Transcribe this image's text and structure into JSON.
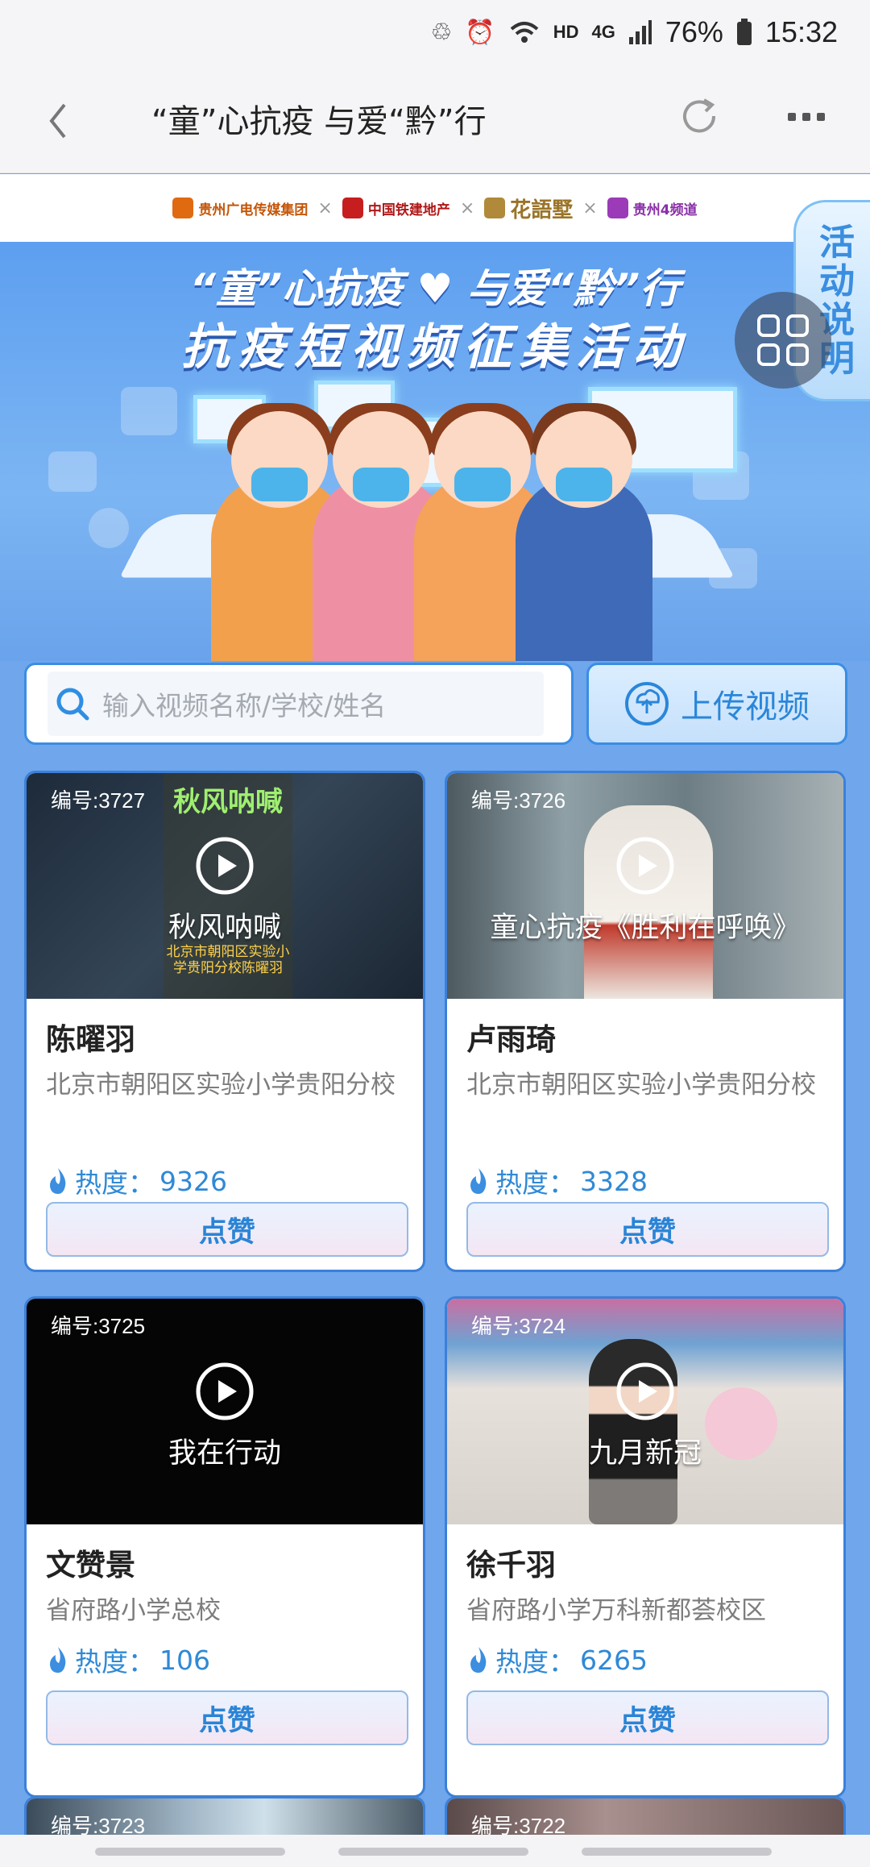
{
  "status_bar": {
    "icons": [
      "sync-icon",
      "alarm-icon",
      "wifi-icon",
      "signal-icon",
      "battery-icon"
    ],
    "hd_label": "HD",
    "network_label": "4G",
    "battery": "76%",
    "time": "15:32"
  },
  "nav": {
    "title": "“童”心抗疫 与爱“黔”行",
    "back_icon": "chevron-left-icon",
    "refresh_icon": "refresh-icon",
    "more_icon": "more-icon"
  },
  "sponsors": [
    {
      "name": "贵州广电传媒集团",
      "color": "#e06a10"
    },
    {
      "name": "中国铁建地产",
      "color": "#c61e1e"
    },
    {
      "name": "花語墅",
      "color": "#b08a3a"
    },
    {
      "name": "贵州4频道",
      "color": "#9b3bb8"
    }
  ],
  "sponsor_separator": "×",
  "banner": {
    "title_line1": "“童”心抗疫 ♥ 与爱“黔”行",
    "title_line2": "抗疫短视频征集活动"
  },
  "side_tab": {
    "label": "活动说明"
  },
  "search": {
    "placeholder": "输入视频名称/学校/姓名"
  },
  "upload": {
    "label": "上传视频"
  },
  "cards": [
    {
      "id_label": "编号:3727",
      "caption": "秋风呐喊",
      "name": "陈曜羽",
      "school": "北京市朝阳区实验小学贵阳分校",
      "heat_label": "热度：",
      "heat": "9326",
      "like_label": "点赞"
    },
    {
      "id_label": "编号:3726",
      "caption": "童心抗疫《胜利在呼唤》",
      "name": "卢雨琦",
      "school": "北京市朝阳区实验小学贵阳分校",
      "heat_label": "热度：",
      "heat": "3328",
      "like_label": "点赞"
    },
    {
      "id_label": "编号:3725",
      "caption": "我在行动",
      "name": "文赞景",
      "school": "省府路小学总校",
      "heat_label": "热度：",
      "heat": "106",
      "like_label": "点赞"
    },
    {
      "id_label": "编号:3724",
      "caption": "九月新冠",
      "name": "徐千羽",
      "school": "省府路小学万科新都荟校区",
      "heat_label": "热度：",
      "heat": "6265",
      "like_label": "点赞"
    }
  ],
  "partial_cards": [
    {
      "id_label": "编号:3723"
    },
    {
      "id_label": "编号:3722"
    }
  ],
  "thumb_overlay": {
    "card0_top_text": "秋风呐喊",
    "card0_sub_text": "北京市朝阳区实验小学贵阳分校陈曜羽"
  }
}
